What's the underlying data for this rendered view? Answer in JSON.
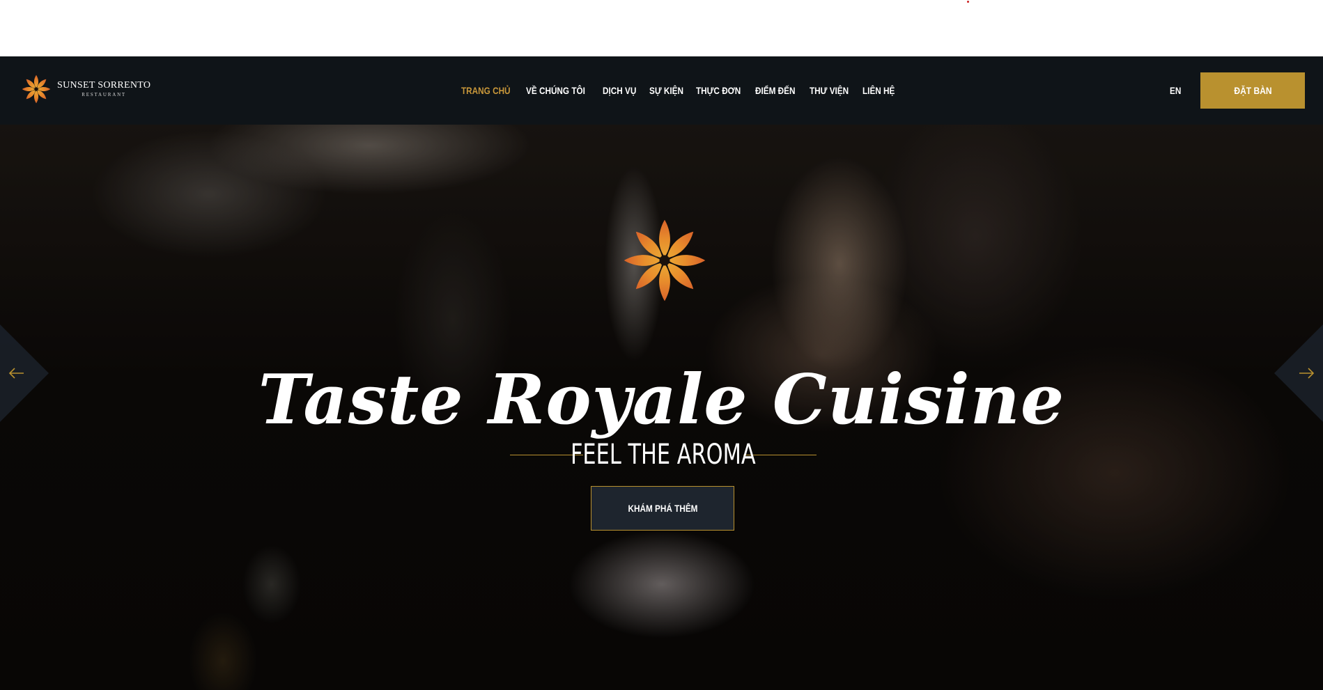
{
  "brand": {
    "name": "SUNSET SORRENTO",
    "subtitle": "RESTAURANT",
    "accent_color": "#c8973a",
    "gold_color": "#b9912f",
    "navbar_color": "#0f1418"
  },
  "nav": {
    "items": [
      {
        "label": "TRANG CHỦ",
        "active": true
      },
      {
        "label": "VỀ CHÚNG TÔI",
        "active": false
      },
      {
        "label": "DỊCH VỤ",
        "active": false
      },
      {
        "label": "SỰ KIỆN",
        "active": false
      },
      {
        "label": "THỰC ĐƠN",
        "active": false
      },
      {
        "label": "ĐIỂM ĐẾN",
        "active": false
      },
      {
        "label": "THƯ VIỆN",
        "active": false
      },
      {
        "label": "LIÊN HỆ",
        "active": false
      }
    ],
    "language": "EN",
    "book_button": "ĐẶT BÀN"
  },
  "hero": {
    "title": "Taste Royale Cuisine",
    "subtitle": "FEEL THE AROMA",
    "cta": "KHÁM PHÁ THÊM",
    "prev_icon": "arrow-left-icon",
    "next_icon": "arrow-right-icon",
    "emblem_icon": "star-flower-icon"
  }
}
